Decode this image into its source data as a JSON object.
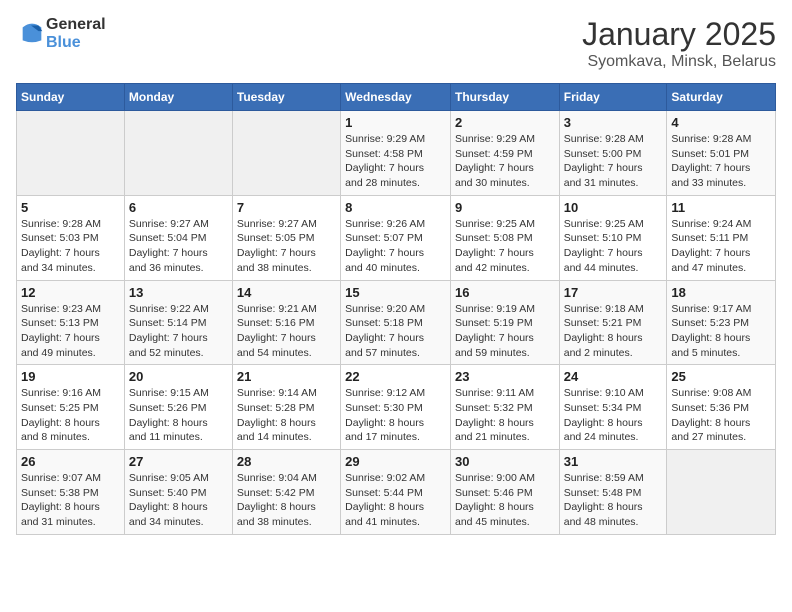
{
  "header": {
    "logo_general": "General",
    "logo_blue": "Blue",
    "month_year": "January 2025",
    "location": "Syomkava, Minsk, Belarus"
  },
  "days_of_week": [
    "Sunday",
    "Monday",
    "Tuesday",
    "Wednesday",
    "Thursday",
    "Friday",
    "Saturday"
  ],
  "weeks": [
    [
      {
        "day": "",
        "info": ""
      },
      {
        "day": "",
        "info": ""
      },
      {
        "day": "",
        "info": ""
      },
      {
        "day": "1",
        "info": "Sunrise: 9:29 AM\nSunset: 4:58 PM\nDaylight: 7 hours\nand 28 minutes."
      },
      {
        "day": "2",
        "info": "Sunrise: 9:29 AM\nSunset: 4:59 PM\nDaylight: 7 hours\nand 30 minutes."
      },
      {
        "day": "3",
        "info": "Sunrise: 9:28 AM\nSunset: 5:00 PM\nDaylight: 7 hours\nand 31 minutes."
      },
      {
        "day": "4",
        "info": "Sunrise: 9:28 AM\nSunset: 5:01 PM\nDaylight: 7 hours\nand 33 minutes."
      }
    ],
    [
      {
        "day": "5",
        "info": "Sunrise: 9:28 AM\nSunset: 5:03 PM\nDaylight: 7 hours\nand 34 minutes."
      },
      {
        "day": "6",
        "info": "Sunrise: 9:27 AM\nSunset: 5:04 PM\nDaylight: 7 hours\nand 36 minutes."
      },
      {
        "day": "7",
        "info": "Sunrise: 9:27 AM\nSunset: 5:05 PM\nDaylight: 7 hours\nand 38 minutes."
      },
      {
        "day": "8",
        "info": "Sunrise: 9:26 AM\nSunset: 5:07 PM\nDaylight: 7 hours\nand 40 minutes."
      },
      {
        "day": "9",
        "info": "Sunrise: 9:25 AM\nSunset: 5:08 PM\nDaylight: 7 hours\nand 42 minutes."
      },
      {
        "day": "10",
        "info": "Sunrise: 9:25 AM\nSunset: 5:10 PM\nDaylight: 7 hours\nand 44 minutes."
      },
      {
        "day": "11",
        "info": "Sunrise: 9:24 AM\nSunset: 5:11 PM\nDaylight: 7 hours\nand 47 minutes."
      }
    ],
    [
      {
        "day": "12",
        "info": "Sunrise: 9:23 AM\nSunset: 5:13 PM\nDaylight: 7 hours\nand 49 minutes."
      },
      {
        "day": "13",
        "info": "Sunrise: 9:22 AM\nSunset: 5:14 PM\nDaylight: 7 hours\nand 52 minutes."
      },
      {
        "day": "14",
        "info": "Sunrise: 9:21 AM\nSunset: 5:16 PM\nDaylight: 7 hours\nand 54 minutes."
      },
      {
        "day": "15",
        "info": "Sunrise: 9:20 AM\nSunset: 5:18 PM\nDaylight: 7 hours\nand 57 minutes."
      },
      {
        "day": "16",
        "info": "Sunrise: 9:19 AM\nSunset: 5:19 PM\nDaylight: 7 hours\nand 59 minutes."
      },
      {
        "day": "17",
        "info": "Sunrise: 9:18 AM\nSunset: 5:21 PM\nDaylight: 8 hours\nand 2 minutes."
      },
      {
        "day": "18",
        "info": "Sunrise: 9:17 AM\nSunset: 5:23 PM\nDaylight: 8 hours\nand 5 minutes."
      }
    ],
    [
      {
        "day": "19",
        "info": "Sunrise: 9:16 AM\nSunset: 5:25 PM\nDaylight: 8 hours\nand 8 minutes."
      },
      {
        "day": "20",
        "info": "Sunrise: 9:15 AM\nSunset: 5:26 PM\nDaylight: 8 hours\nand 11 minutes."
      },
      {
        "day": "21",
        "info": "Sunrise: 9:14 AM\nSunset: 5:28 PM\nDaylight: 8 hours\nand 14 minutes."
      },
      {
        "day": "22",
        "info": "Sunrise: 9:12 AM\nSunset: 5:30 PM\nDaylight: 8 hours\nand 17 minutes."
      },
      {
        "day": "23",
        "info": "Sunrise: 9:11 AM\nSunset: 5:32 PM\nDaylight: 8 hours\nand 21 minutes."
      },
      {
        "day": "24",
        "info": "Sunrise: 9:10 AM\nSunset: 5:34 PM\nDaylight: 8 hours\nand 24 minutes."
      },
      {
        "day": "25",
        "info": "Sunrise: 9:08 AM\nSunset: 5:36 PM\nDaylight: 8 hours\nand 27 minutes."
      }
    ],
    [
      {
        "day": "26",
        "info": "Sunrise: 9:07 AM\nSunset: 5:38 PM\nDaylight: 8 hours\nand 31 minutes."
      },
      {
        "day": "27",
        "info": "Sunrise: 9:05 AM\nSunset: 5:40 PM\nDaylight: 8 hours\nand 34 minutes."
      },
      {
        "day": "28",
        "info": "Sunrise: 9:04 AM\nSunset: 5:42 PM\nDaylight: 8 hours\nand 38 minutes."
      },
      {
        "day": "29",
        "info": "Sunrise: 9:02 AM\nSunset: 5:44 PM\nDaylight: 8 hours\nand 41 minutes."
      },
      {
        "day": "30",
        "info": "Sunrise: 9:00 AM\nSunset: 5:46 PM\nDaylight: 8 hours\nand 45 minutes."
      },
      {
        "day": "31",
        "info": "Sunrise: 8:59 AM\nSunset: 5:48 PM\nDaylight: 8 hours\nand 48 minutes."
      },
      {
        "day": "",
        "info": ""
      }
    ]
  ]
}
